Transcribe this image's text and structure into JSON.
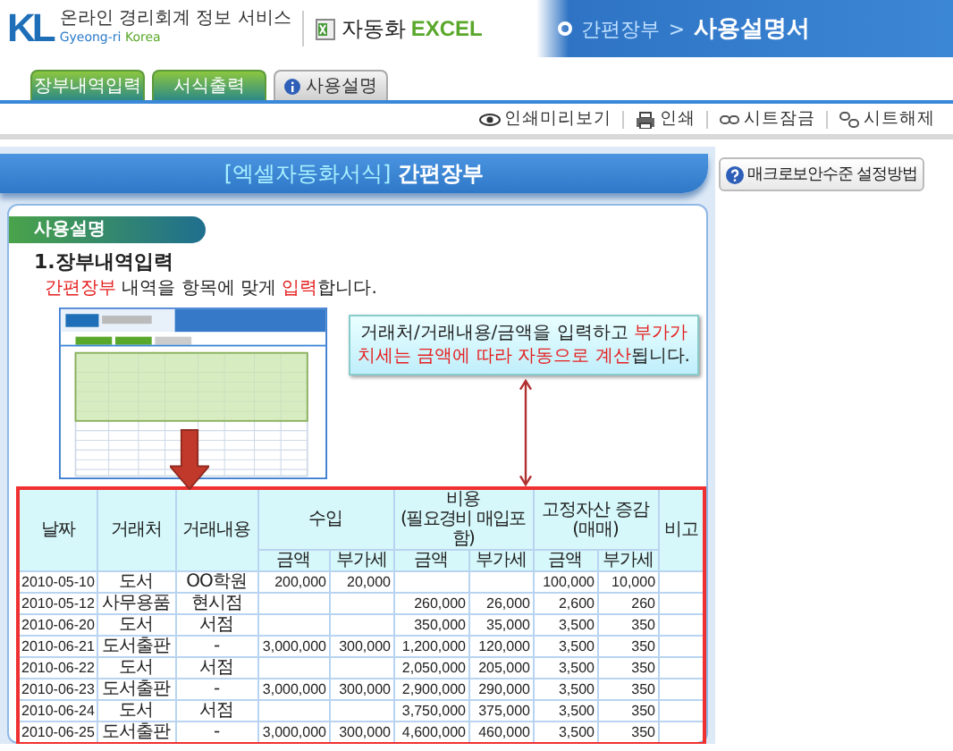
{
  "header": {
    "logo": {
      "mark": "KL",
      "tagline": "온라인 경리회계 정보 서비스",
      "brand_1": "Gyeong-ri",
      "brand_2": "Korea"
    },
    "product": {
      "name": "자동화",
      "suffix": "EXCEL"
    },
    "breadcrumb": [
      {
        "label": "간편장부",
        "current": false
      },
      {
        "label": ">",
        "current": false
      },
      {
        "label": "사용설명서",
        "current": true
      }
    ]
  },
  "tabs": [
    {
      "label": "장부내역입력",
      "selected": false
    },
    {
      "label": "서식출력",
      "selected": false
    },
    {
      "label": "사용설명",
      "selected": true
    }
  ],
  "toolbar": [
    {
      "label": "인쇄미리보기",
      "kind": "preview"
    },
    {
      "label": "인쇄",
      "kind": "print"
    },
    {
      "label": "시트잠금",
      "kind": "lock"
    },
    {
      "label": "시트해제",
      "kind": "unlock"
    }
  ],
  "banner": {
    "prefix": "[엑셀자동화서식]",
    "title": "간편장부"
  },
  "sidebar": {
    "help_button": "매크로보안수준 설정방법"
  },
  "section": {
    "title": "사용설명",
    "heading": "1.장부내역입력",
    "instruction": [
      {
        "text": "간편장부",
        "highlight": true
      },
      {
        "text": " 내역을 항목에 맞게 ",
        "highlight": false
      },
      {
        "text": "입력",
        "highlight": true
      },
      {
        "text": "합니다.",
        "highlight": false
      }
    ],
    "callout": [
      {
        "text": "거래처/거래내용/금액을 입력하고 ",
        "highlight": false
      },
      {
        "text": "부가가치세는 금액에 따라 자동으로 계산",
        "highlight": true
      },
      {
        "text": "됩니다.",
        "highlight": false
      }
    ]
  },
  "table": {
    "header_rows": [
      [
        {
          "label": "날짜",
          "rowspan": 2
        },
        {
          "label": "거래처",
          "rowspan": 2
        },
        {
          "label": "거래내용",
          "rowspan": 2
        },
        {
          "label": "수입",
          "colspan": 2
        },
        {
          "label": "비용",
          "note": "(필요경비 매입포함)",
          "colspan": 2
        },
        {
          "label": "고정자산 증감(매매)",
          "colspan": 2
        },
        {
          "label": "비고",
          "rowspan": 2
        }
      ],
      [
        {
          "label": "금액"
        },
        {
          "label": "부가세"
        },
        {
          "label": "금액"
        },
        {
          "label": "부가세"
        },
        {
          "label": "금액"
        },
        {
          "label": "부가세"
        }
      ]
    ],
    "rows": [
      [
        "2010-05-10",
        "도서",
        "OO학원",
        "200,000",
        "20,000",
        null,
        null,
        "100,000",
        "10,000",
        null
      ],
      [
        "2010-05-12",
        "사무용품",
        "현시점",
        null,
        null,
        "260,000",
        "26,000",
        "2,600",
        "260",
        null
      ],
      [
        "2010-06-20",
        "도서",
        "서점",
        null,
        null,
        "350,000",
        "35,000",
        "3,500",
        "350",
        null
      ],
      [
        "2010-06-21",
        "도서출판",
        "-",
        "3,000,000",
        "300,000",
        "1,200,000",
        "120,000",
        "3,500",
        "350",
        null
      ],
      [
        "2010-06-22",
        "도서",
        "서점",
        null,
        null,
        "2,050,000",
        "205,000",
        "3,500",
        "350",
        null
      ],
      [
        "2010-06-23",
        "도서출판",
        "-",
        "3,000,000",
        "300,000",
        "2,900,000",
        "290,000",
        "3,500",
        "350",
        null
      ],
      [
        "2010-06-24",
        "도서",
        "서점",
        null,
        null,
        "3,750,000",
        "375,000",
        "3,500",
        "350",
        null
      ],
      [
        "2010-06-25",
        "도서출판",
        "-",
        "3,000,000",
        "300,000",
        "4,600,000",
        "460,000",
        "3,500",
        "350",
        null
      ]
    ]
  }
}
